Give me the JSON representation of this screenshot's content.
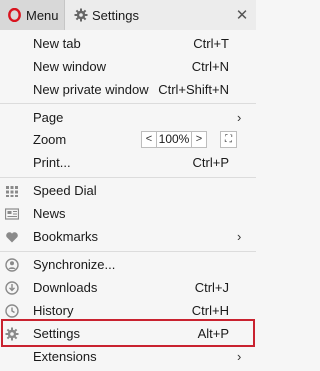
{
  "topbar": {
    "menu_label": "Menu",
    "settings_tab_label": "Settings",
    "close_glyph": "✕"
  },
  "menu": {
    "new_tab": {
      "label": "New tab",
      "shortcut": "Ctrl+T"
    },
    "new_window": {
      "label": "New window",
      "shortcut": "Ctrl+N"
    },
    "new_private_window": {
      "label": "New private window",
      "shortcut": "Ctrl+Shift+N"
    },
    "page": {
      "label": "Page",
      "arrow": "›"
    },
    "zoom": {
      "label": "Zoom",
      "decrease": "<",
      "value": "100%",
      "increase": ">",
      "fullscreen": "⛶"
    },
    "print": {
      "label": "Print...",
      "shortcut": "Ctrl+P"
    },
    "speed_dial": {
      "label": "Speed Dial"
    },
    "news": {
      "label": "News"
    },
    "bookmarks": {
      "label": "Bookmarks",
      "arrow": "›"
    },
    "synchronize": {
      "label": "Synchronize..."
    },
    "downloads": {
      "label": "Downloads",
      "shortcut": "Ctrl+J"
    },
    "history": {
      "label": "History",
      "shortcut": "Ctrl+H"
    },
    "settings": {
      "label": "Settings",
      "shortcut": "Alt+P",
      "highlighted": true
    },
    "extensions": {
      "label": "Extensions",
      "arrow": "›"
    }
  },
  "colors": {
    "opera_red": "#d9141f",
    "highlight_border": "#c9222f",
    "icon_gray": "#8a8a8a"
  },
  "icons": [
    "opera-logo-icon",
    "gear-icon",
    "close-icon",
    "grid-icon",
    "news-icon",
    "heart-icon",
    "sync-icon",
    "download-icon",
    "clock-icon",
    "chevron-right-icon"
  ]
}
